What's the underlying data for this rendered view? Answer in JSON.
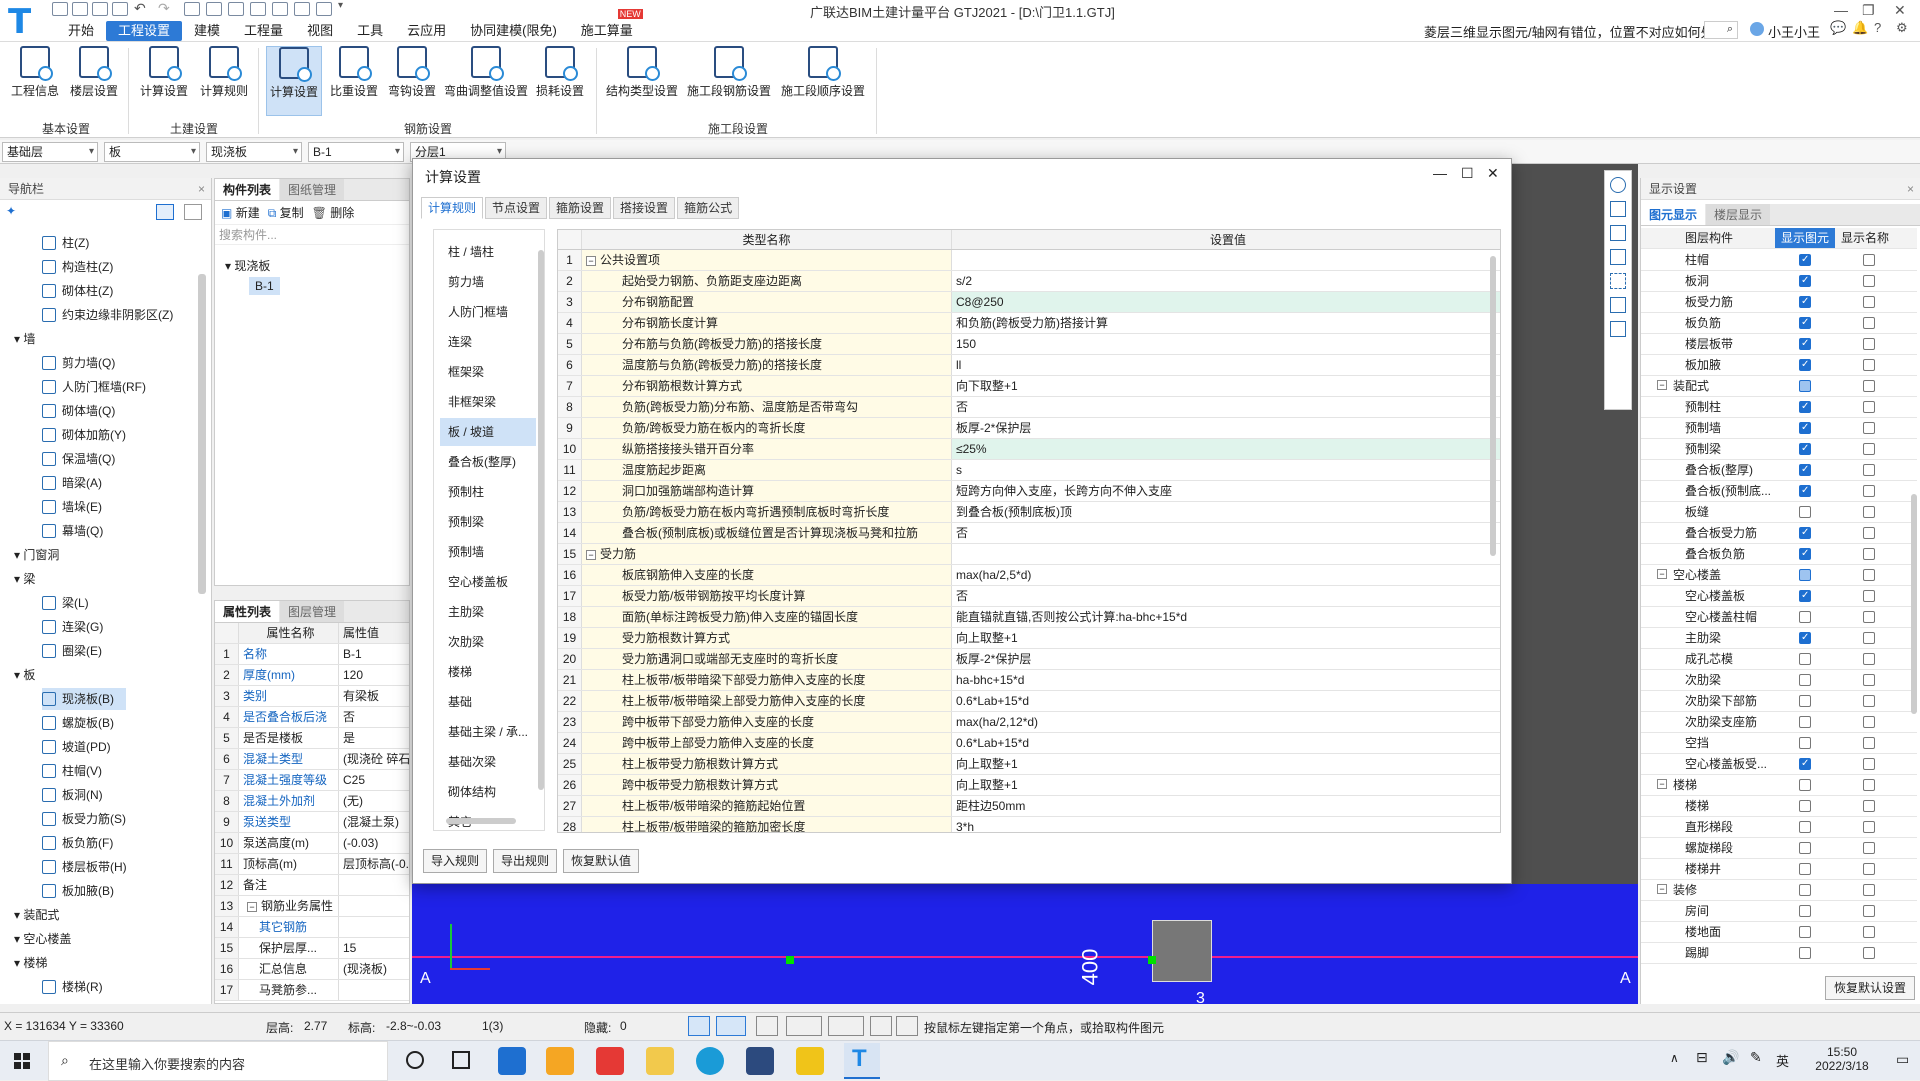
{
  "app": {
    "title": "广联达BIM土建计量平台 GTJ2021 - [D:\\门卫1.1.GTJ]",
    "logo": "T"
  },
  "menus": [
    "开始",
    "工程设置",
    "建模",
    "工程量",
    "视图",
    "工具",
    "云应用",
    "协同建模(限免)",
    "施工算量"
  ],
  "new_badge": "NEW",
  "help_question": "菱层三维显示图元/轴网有错位，位置不对应如何处理?",
  "user": "小王小王",
  "ribbon": {
    "buttons": [
      "工程信息",
      "楼层设置",
      "计算设置",
      "计算规则",
      "计算设置",
      "比重设置",
      "弯钩设置",
      "弯曲调整值设置",
      "损耗设置",
      "结构类型设置",
      "施工段钢筋设置",
      "施工段顺序设置"
    ],
    "groups": [
      "基本设置",
      "土建设置",
      "钢筋设置",
      "施工段设置"
    ]
  },
  "combos": [
    "基础层",
    "板",
    "现浇板",
    "B-1",
    "分层1"
  ],
  "nav": {
    "title": "导航栏",
    "items": [
      {
        "label": "柱(Z)",
        "type": "item"
      },
      {
        "label": "构造柱(Z)",
        "type": "item"
      },
      {
        "label": "砌体柱(Z)",
        "type": "item"
      },
      {
        "label": "约束边缘非阴影区(Z)",
        "type": "item"
      },
      {
        "label": "墙",
        "type": "cat"
      },
      {
        "label": "剪力墙(Q)",
        "type": "item"
      },
      {
        "label": "人防门框墙(RF)",
        "type": "item"
      },
      {
        "label": "砌体墙(Q)",
        "type": "item"
      },
      {
        "label": "砌体加筋(Y)",
        "type": "item"
      },
      {
        "label": "保温墙(Q)",
        "type": "item"
      },
      {
        "label": "暗梁(A)",
        "type": "item"
      },
      {
        "label": "墙垛(E)",
        "type": "item"
      },
      {
        "label": "幕墙(Q)",
        "type": "item"
      },
      {
        "label": "门窗洞",
        "type": "cat"
      },
      {
        "label": "梁",
        "type": "cat"
      },
      {
        "label": "梁(L)",
        "type": "item"
      },
      {
        "label": "连梁(G)",
        "type": "item"
      },
      {
        "label": "圈梁(E)",
        "type": "item"
      },
      {
        "label": "板",
        "type": "cat"
      },
      {
        "label": "现浇板(B)",
        "type": "item",
        "selected": true
      },
      {
        "label": "螺旋板(B)",
        "type": "item"
      },
      {
        "label": "坡道(PD)",
        "type": "item"
      },
      {
        "label": "柱帽(V)",
        "type": "item"
      },
      {
        "label": "板洞(N)",
        "type": "item"
      },
      {
        "label": "板受力筋(S)",
        "type": "item"
      },
      {
        "label": "板负筋(F)",
        "type": "item"
      },
      {
        "label": "楼层板带(H)",
        "type": "item"
      },
      {
        "label": "板加腋(B)",
        "type": "item"
      },
      {
        "label": "装配式",
        "type": "cat"
      },
      {
        "label": "空心楼盖",
        "type": "cat"
      },
      {
        "label": "楼梯",
        "type": "cat"
      },
      {
        "label": "楼梯(R)",
        "type": "item"
      }
    ]
  },
  "complist": {
    "tabs": [
      "构件列表",
      "图纸管理"
    ],
    "toolbar": [
      "新建",
      "复制",
      "删除"
    ],
    "search_placeholder": "搜索构件...",
    "tree_root": "现浇板",
    "tree_child": "B-1"
  },
  "proplist": {
    "tabs": [
      "属性列表",
      "图层管理"
    ],
    "headers": [
      "属性名称",
      "属性值"
    ],
    "rows": [
      {
        "n": "1",
        "k": "名称",
        "v": "B-1",
        "blue": true
      },
      {
        "n": "2",
        "k": "厚度(mm)",
        "v": "120",
        "blue": true
      },
      {
        "n": "3",
        "k": "类别",
        "v": "有梁板",
        "blue": true
      },
      {
        "n": "4",
        "k": "是否叠合板后浇",
        "v": "否",
        "blue": true
      },
      {
        "n": "5",
        "k": "是否是楼板",
        "v": "是",
        "blue": false
      },
      {
        "n": "6",
        "k": "混凝土类型",
        "v": "(现浇砼 碎石",
        "blue": true
      },
      {
        "n": "7",
        "k": "混凝土强度等级",
        "v": "C25",
        "blue": true
      },
      {
        "n": "8",
        "k": "混凝土外加剂",
        "v": "(无)",
        "blue": true
      },
      {
        "n": "9",
        "k": "泵送类型",
        "v": "(混凝土泵)",
        "blue": true
      },
      {
        "n": "10",
        "k": "泵送高度(m)",
        "v": "(-0.03)",
        "blue": false
      },
      {
        "n": "11",
        "k": "顶标高(m)",
        "v": "层顶标高(-0.",
        "blue": false
      },
      {
        "n": "12",
        "k": "备注",
        "v": "",
        "blue": false
      },
      {
        "n": "13",
        "k": "钢筋业务属性",
        "v": "",
        "blue": false,
        "group": true
      },
      {
        "n": "14",
        "k": "其它钢筋",
        "v": "",
        "blue": true,
        "indent": true
      },
      {
        "n": "15",
        "k": "保护层厚...",
        "v": "15",
        "blue": false,
        "indent": true
      },
      {
        "n": "16",
        "k": "汇总信息",
        "v": "(现浇板)",
        "blue": false,
        "indent": true
      },
      {
        "n": "17",
        "k": "马凳筋参...",
        "v": "",
        "blue": false,
        "indent": true
      }
    ]
  },
  "right_panel": {
    "title": "显示设置",
    "tabs": [
      "图元显示",
      "楼层显示"
    ],
    "headers": [
      "图层构件",
      "显示图元",
      "显示名称"
    ],
    "rows": [
      {
        "label": "柱帽",
        "show": true,
        "name": false,
        "level": 1
      },
      {
        "label": "板洞",
        "show": true,
        "name": false,
        "level": 1
      },
      {
        "label": "板受力筋",
        "show": true,
        "name": false,
        "level": 1
      },
      {
        "label": "板负筋",
        "show": true,
        "name": false,
        "level": 1
      },
      {
        "label": "楼层板带",
        "show": true,
        "name": false,
        "level": 1
      },
      {
        "label": "板加腋",
        "show": true,
        "name": false,
        "level": 1
      },
      {
        "label": "装配式",
        "show": "part",
        "name": false,
        "level": 0
      },
      {
        "label": "预制柱",
        "show": true,
        "name": false,
        "level": 1
      },
      {
        "label": "预制墙",
        "show": true,
        "name": false,
        "level": 1
      },
      {
        "label": "预制梁",
        "show": true,
        "name": false,
        "level": 1
      },
      {
        "label": "叠合板(整厚)",
        "show": true,
        "name": false,
        "level": 1
      },
      {
        "label": "叠合板(预制底...",
        "show": true,
        "name": false,
        "level": 1
      },
      {
        "label": "板缝",
        "show": false,
        "name": false,
        "level": 1
      },
      {
        "label": "叠合板受力筋",
        "show": true,
        "name": false,
        "level": 1
      },
      {
        "label": "叠合板负筋",
        "show": true,
        "name": false,
        "level": 1
      },
      {
        "label": "空心楼盖",
        "show": "part",
        "name": false,
        "level": 0
      },
      {
        "label": "空心楼盖板",
        "show": true,
        "name": false,
        "level": 1
      },
      {
        "label": "空心楼盖柱帽",
        "show": false,
        "name": false,
        "level": 1
      },
      {
        "label": "主肋梁",
        "show": true,
        "name": false,
        "level": 1
      },
      {
        "label": "成孔芯模",
        "show": false,
        "name": false,
        "level": 1
      },
      {
        "label": "次肋梁",
        "show": false,
        "name": false,
        "level": 1
      },
      {
        "label": "次肋梁下部筋",
        "show": false,
        "name": false,
        "level": 1
      },
      {
        "label": "次肋梁支座筋",
        "show": false,
        "name": false,
        "level": 1
      },
      {
        "label": "空挡",
        "show": false,
        "name": false,
        "level": 1
      },
      {
        "label": "空心楼盖板受...",
        "show": true,
        "name": false,
        "level": 1
      },
      {
        "label": "楼梯",
        "show": false,
        "name": false,
        "level": 0
      },
      {
        "label": "楼梯",
        "show": false,
        "name": false,
        "level": 1
      },
      {
        "label": "直形梯段",
        "show": false,
        "name": false,
        "level": 1
      },
      {
        "label": "螺旋梯段",
        "show": false,
        "name": false,
        "level": 1
      },
      {
        "label": "楼梯井",
        "show": false,
        "name": false,
        "level": 1
      },
      {
        "label": "装修",
        "show": false,
        "name": false,
        "level": 0
      },
      {
        "label": "房间",
        "show": false,
        "name": false,
        "level": 1
      },
      {
        "label": "楼地面",
        "show": false,
        "name": false,
        "level": 1
      },
      {
        "label": "踢脚",
        "show": false,
        "name": false,
        "level": 1
      }
    ],
    "restore_button": "恢复默认设置"
  },
  "dialog": {
    "title": "计算设置",
    "tabs": [
      "计算规则",
      "节点设置",
      "箍筋设置",
      "搭接设置",
      "箍筋公式"
    ],
    "categories": [
      "柱 / 墙柱",
      "剪力墙",
      "人防门框墙",
      "连梁",
      "框架梁",
      "非框架梁",
      "板 / 坡道",
      "叠合板(整厚)",
      "预制柱",
      "预制梁",
      "预制墙",
      "空心楼盖板",
      "主肋梁",
      "次肋梁",
      "楼梯",
      "基础",
      "基础主梁 / 承...",
      "基础次梁",
      "砌体结构",
      "其它"
    ],
    "selected_category": "板 / 坡道",
    "grid_headers": [
      "类型名称",
      "设置值"
    ],
    "rows": [
      {
        "n": "1",
        "k": "公共设置项",
        "v": "",
        "group": true
      },
      {
        "n": "2",
        "k": "起始受力钢筋、负筋距支座边距离",
        "v": "s/2"
      },
      {
        "n": "3",
        "k": "分布钢筋配置",
        "v": "C8@250",
        "hl": true
      },
      {
        "n": "4",
        "k": "分布钢筋长度计算",
        "v": "和负筋(跨板受力筋)搭接计算"
      },
      {
        "n": "5",
        "k": "分布筋与负筋(跨板受力筋)的搭接长度",
        "v": "150"
      },
      {
        "n": "6",
        "k": "温度筋与负筋(跨板受力筋)的搭接长度",
        "v": "ll"
      },
      {
        "n": "7",
        "k": "分布钢筋根数计算方式",
        "v": "向下取整+1"
      },
      {
        "n": "8",
        "k": "负筋(跨板受力筋)分布筋、温度筋是否带弯勾",
        "v": "否"
      },
      {
        "n": "9",
        "k": "负筋/跨板受力筋在板内的弯折长度",
        "v": "板厚-2*保护层"
      },
      {
        "n": "10",
        "k": "纵筋搭接接头错开百分率",
        "v": "≤25%",
        "hl": true
      },
      {
        "n": "11",
        "k": "温度筋起步距离",
        "v": "s"
      },
      {
        "n": "12",
        "k": "洞口加强筋端部构造计算",
        "v": "短跨方向伸入支座，长跨方向不伸入支座"
      },
      {
        "n": "13",
        "k": "负筋/跨板受力筋在板内弯折遇预制底板时弯折长度",
        "v": "到叠合板(预制底板)顶"
      },
      {
        "n": "14",
        "k": "叠合板(预制底板)或板缝位置是否计算现浇板马凳和拉筋",
        "v": "否"
      },
      {
        "n": "15",
        "k": "受力筋",
        "v": "",
        "group": true
      },
      {
        "n": "16",
        "k": "板底钢筋伸入支座的长度",
        "v": "max(ha/2,5*d)"
      },
      {
        "n": "17",
        "k": "板受力筋/板带钢筋按平均长度计算",
        "v": "否"
      },
      {
        "n": "18",
        "k": "面筋(单标注跨板受力筋)伸入支座的锚固长度",
        "v": "能直锚就直锚,否则按公式计算:ha-bhc+15*d"
      },
      {
        "n": "19",
        "k": "受力筋根数计算方式",
        "v": "向上取整+1"
      },
      {
        "n": "20",
        "k": "受力筋遇洞口或端部无支座时的弯折长度",
        "v": "板厚-2*保护层"
      },
      {
        "n": "21",
        "k": "柱上板带/板带暗梁下部受力筋伸入支座的长度",
        "v": "ha-bhc+15*d"
      },
      {
        "n": "22",
        "k": "柱上板带/板带暗梁上部受力筋伸入支座的长度",
        "v": "0.6*Lab+15*d"
      },
      {
        "n": "23",
        "k": "跨中板带下部受力筋伸入支座的长度",
        "v": "max(ha/2,12*d)"
      },
      {
        "n": "24",
        "k": "跨中板带上部受力筋伸入支座的长度",
        "v": "0.6*Lab+15*d"
      },
      {
        "n": "25",
        "k": "柱上板带受力筋根数计算方式",
        "v": "向上取整+1"
      },
      {
        "n": "26",
        "k": "跨中板带受力筋根数计算方式",
        "v": "向上取整+1"
      },
      {
        "n": "27",
        "k": "柱上板带/板带暗梁的箍筋起始位置",
        "v": "距柱边50mm"
      },
      {
        "n": "28",
        "k": "柱上板带/板带暗梁的箍筋加密长度",
        "v": "3*h"
      }
    ],
    "buttons": [
      "导入规则",
      "导出规则",
      "恢复默认值"
    ]
  },
  "canvas": {
    "axis_a": "A",
    "axis_3": "3",
    "dim_400": "400"
  },
  "status": {
    "coords": "X = 131634 Y = 33360",
    "floor_height_label": "层高:",
    "floor_height": "2.77",
    "elev_label": "标高:",
    "elev": "-2.8~-0.03",
    "count": "1(3)",
    "hidden_label": "隐藏:",
    "hidden": "0",
    "hint": "按鼠标左键指定第一个角点，或拾取构件图元"
  },
  "taskbar": {
    "search": "在这里输入你要搜索的内容",
    "time": "15:50",
    "date": "2022/3/18",
    "ime": "英"
  }
}
